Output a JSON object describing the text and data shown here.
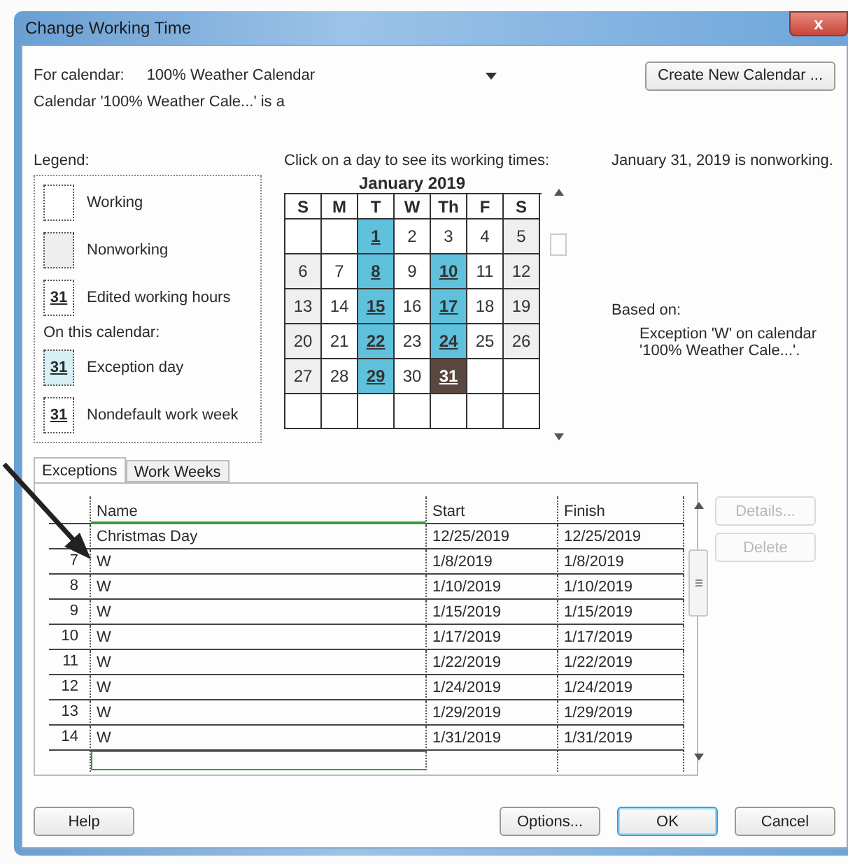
{
  "window": {
    "title": "Change Working Time",
    "close": "x"
  },
  "for_calendar": {
    "label": "For calendar:",
    "value": "100% Weather Calendar"
  },
  "create_button": "Create New Calendar ...",
  "calendar_note": "Calendar '100% Weather Cale...' is a",
  "legend": {
    "title": "Legend:",
    "subtitle": "On this calendar:",
    "items": [
      {
        "kind": "working",
        "label": "Working"
      },
      {
        "kind": "nonworking",
        "label": "Nonworking"
      },
      {
        "kind": "edited",
        "day": "31",
        "label": "Edited working hours"
      },
      {
        "kind": "exception",
        "day": "31",
        "label": "Exception day"
      },
      {
        "kind": "nondefault",
        "day": "31",
        "label": "Nondefault work week"
      }
    ]
  },
  "calendar": {
    "prompt": "Click on a day to see its working times:",
    "month": "January 2019",
    "weekdays": [
      "S",
      "M",
      "T",
      "W",
      "Th",
      "F",
      "S"
    ],
    "weeks": [
      [
        {
          "kind": "blank"
        },
        {
          "kind": "blank"
        },
        {
          "day": "1",
          "kind": "exception",
          "selected": false
        },
        {
          "day": "2",
          "kind": "working",
          "selected": false
        },
        {
          "day": "3",
          "kind": "working",
          "selected": false
        },
        {
          "day": "4",
          "kind": "working",
          "selected": false
        },
        {
          "day": "5",
          "kind": "nonworking",
          "selected": false
        }
      ],
      [
        {
          "day": "6",
          "kind": "nonworking",
          "selected": false
        },
        {
          "day": "7",
          "kind": "working",
          "selected": false
        },
        {
          "day": "8",
          "kind": "exception",
          "selected": false
        },
        {
          "day": "9",
          "kind": "working",
          "selected": false
        },
        {
          "day": "10",
          "kind": "exception",
          "selected": false
        },
        {
          "day": "11",
          "kind": "working",
          "selected": false
        },
        {
          "day": "12",
          "kind": "nonworking",
          "selected": false
        }
      ],
      [
        {
          "day": "13",
          "kind": "nonworking",
          "selected": false
        },
        {
          "day": "14",
          "kind": "working",
          "selected": false
        },
        {
          "day": "15",
          "kind": "exception",
          "selected": false
        },
        {
          "day": "16",
          "kind": "working",
          "selected": false
        },
        {
          "day": "17",
          "kind": "exception",
          "selected": false
        },
        {
          "day": "18",
          "kind": "working",
          "selected": false
        },
        {
          "day": "19",
          "kind": "nonworking",
          "selected": false
        }
      ],
      [
        {
          "day": "20",
          "kind": "nonworking",
          "selected": false
        },
        {
          "day": "21",
          "kind": "working",
          "selected": false
        },
        {
          "day": "22",
          "kind": "exception",
          "selected": false
        },
        {
          "day": "23",
          "kind": "working",
          "selected": false
        },
        {
          "day": "24",
          "kind": "exception",
          "selected": false
        },
        {
          "day": "25",
          "kind": "working",
          "selected": false
        },
        {
          "day": "26",
          "kind": "nonworking",
          "selected": false
        }
      ],
      [
        {
          "day": "27",
          "kind": "nonworking",
          "selected": false
        },
        {
          "day": "28",
          "kind": "working",
          "selected": false
        },
        {
          "day": "29",
          "kind": "exception",
          "selected": false
        },
        {
          "day": "30",
          "kind": "working",
          "selected": false
        },
        {
          "day": "31",
          "kind": "exception",
          "selected": true
        },
        {
          "kind": "blank"
        },
        {
          "kind": "blank"
        }
      ],
      [
        {
          "kind": "blank"
        },
        {
          "kind": "blank"
        },
        {
          "kind": "blank"
        },
        {
          "kind": "blank"
        },
        {
          "kind": "blank"
        },
        {
          "kind": "blank"
        },
        {
          "kind": "blank"
        }
      ]
    ]
  },
  "day_status": "January 31, 2019 is nonworking.",
  "based_on": {
    "label": "Based on:",
    "text": "Exception 'W' on calendar '100% Weather Cale...'."
  },
  "tabs": [
    {
      "label": "Exceptions",
      "selected": true
    },
    {
      "label": "Work Weeks",
      "selected": false
    }
  ],
  "table": {
    "columns": [
      "Name",
      "Start",
      "Finish"
    ],
    "rows": [
      {
        "name": "Christmas Day",
        "start": "12/25/2019",
        "finish": "12/25/2019"
      },
      {
        "number": "7",
        "name": "W",
        "start": "1/8/2019",
        "finish": "1/8/2019"
      },
      {
        "number": "8",
        "name": "W",
        "start": "1/10/2019",
        "finish": "1/10/2019"
      },
      {
        "number": "9",
        "name": "W",
        "start": "1/15/2019",
        "finish": "1/15/2019"
      },
      {
        "number": "10",
        "name": "W",
        "start": "1/17/2019",
        "finish": "1/17/2019"
      },
      {
        "number": "11",
        "name": "W",
        "start": "1/22/2019",
        "finish": "1/22/2019"
      },
      {
        "number": "12",
        "name": "W",
        "start": "1/24/2019",
        "finish": "1/24/2019"
      },
      {
        "number": "13",
        "name": "W",
        "start": "1/29/2019",
        "finish": "1/29/2019"
      },
      {
        "number": "14",
        "name": "W",
        "start": "1/31/2019",
        "finish": "1/31/2019"
      }
    ]
  },
  "side_buttons": [
    {
      "label": "Details...",
      "disabled": true
    },
    {
      "label": "Delete",
      "disabled": true
    }
  ],
  "footer": {
    "help": "Help",
    "buttons": [
      {
        "label": "Options...",
        "default": false
      },
      {
        "label": "OK",
        "default": true
      },
      {
        "label": "Cancel",
        "default": false
      }
    ]
  }
}
